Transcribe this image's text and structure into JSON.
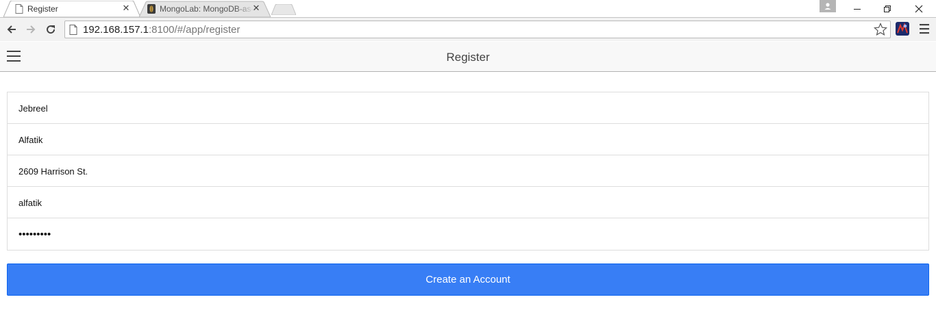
{
  "browser": {
    "tabs": [
      {
        "title": "Register",
        "close_glyph": "✕",
        "icon": "page-icon",
        "active": true
      },
      {
        "title": "MongoLab: MongoDB-as-a-Service",
        "close_glyph": "✕",
        "icon": "mongolab-icon",
        "active": false
      }
    ],
    "address": {
      "host": "192.168.157.1",
      "rest": ":8100/#/app/register"
    }
  },
  "header": {
    "title": "Register"
  },
  "form": {
    "fields": [
      {
        "name": "first-name",
        "value": "Jebreel",
        "type": "text"
      },
      {
        "name": "last-name",
        "value": "Alfatik",
        "type": "text"
      },
      {
        "name": "address",
        "value": "2609 Harrison St.",
        "type": "text"
      },
      {
        "name": "username",
        "value": "alfatik",
        "type": "text"
      },
      {
        "name": "password",
        "value": "•••••••••",
        "type": "password"
      }
    ],
    "submit_label": "Create an Account"
  },
  "colors": {
    "primary": "#387ef5",
    "header_bg": "#f8f8f8"
  }
}
